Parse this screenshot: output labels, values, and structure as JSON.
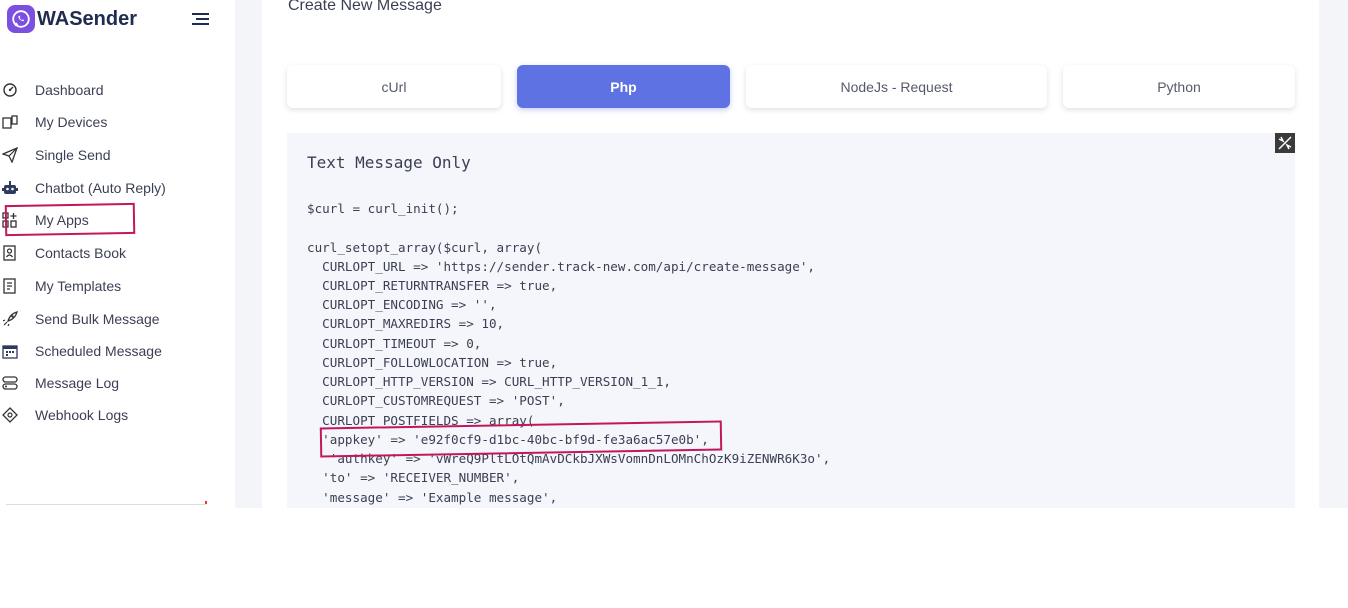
{
  "sidebar": {
    "brand": "WASender",
    "items": [
      {
        "label": "Dashboard",
        "icon": "dashboard-icon"
      },
      {
        "label": "My Devices",
        "icon": "devices-icon"
      },
      {
        "label": "Single Send",
        "icon": "send-icon"
      },
      {
        "label": "Chatbot (Auto Reply)",
        "icon": "robot-icon"
      },
      {
        "label": "My Apps",
        "icon": "apps-icon"
      },
      {
        "label": "Contacts Book",
        "icon": "contacts-icon"
      },
      {
        "label": "My Templates",
        "icon": "templates-icon"
      },
      {
        "label": "Send Bulk Message",
        "icon": "rocket-icon"
      },
      {
        "label": "Scheduled Message",
        "icon": "calendar-icon"
      },
      {
        "label": "Message Log",
        "icon": "log-icon"
      },
      {
        "label": "Webhook Logs",
        "icon": "webhook-icon"
      }
    ]
  },
  "main": {
    "title": "Create New Message",
    "tabs": [
      {
        "label": "cUrl",
        "active": false
      },
      {
        "label": "Php",
        "active": true
      },
      {
        "label": "NodeJs - Request",
        "active": false
      },
      {
        "label": "Python",
        "active": false
      }
    ],
    "code": {
      "title": "Text Message Only",
      "lines": [
        "$curl = curl_init();",
        "curl_setopt_array($curl, array(",
        "  CURLOPT_URL => 'https://sender.track-new.com/api/create-message',",
        "  CURLOPT_RETURNTRANSFER => true,",
        "  CURLOPT_ENCODING => '',",
        "  CURLOPT_MAXREDIRS => 10,",
        "  CURLOPT_TIMEOUT => 0,",
        "  CURLOPT_FOLLOWLOCATION => true,",
        "  CURLOPT_HTTP_VERSION => CURL_HTTP_VERSION_1_1,",
        "  CURLOPT_CUSTOMREQUEST => 'POST',",
        "  CURLOPT_POSTFIELDS => array(",
        "  'appkey' => 'e92f0cf9-d1bc-40bc-bf9d-fe3a6ac57e0b',",
        "   'authkey' => 'vWreQ9PltLOtQmAvDCkbJXWsVomnDnLOMnChOzK9iZENWR6K3o',",
        "  'to' => 'RECEIVER_NUMBER',",
        "  'message' => 'Example message',"
      ]
    }
  },
  "colors": {
    "accent": "#5e72e4",
    "brand": "#7b4fe0",
    "annotation": "#c2185b"
  }
}
